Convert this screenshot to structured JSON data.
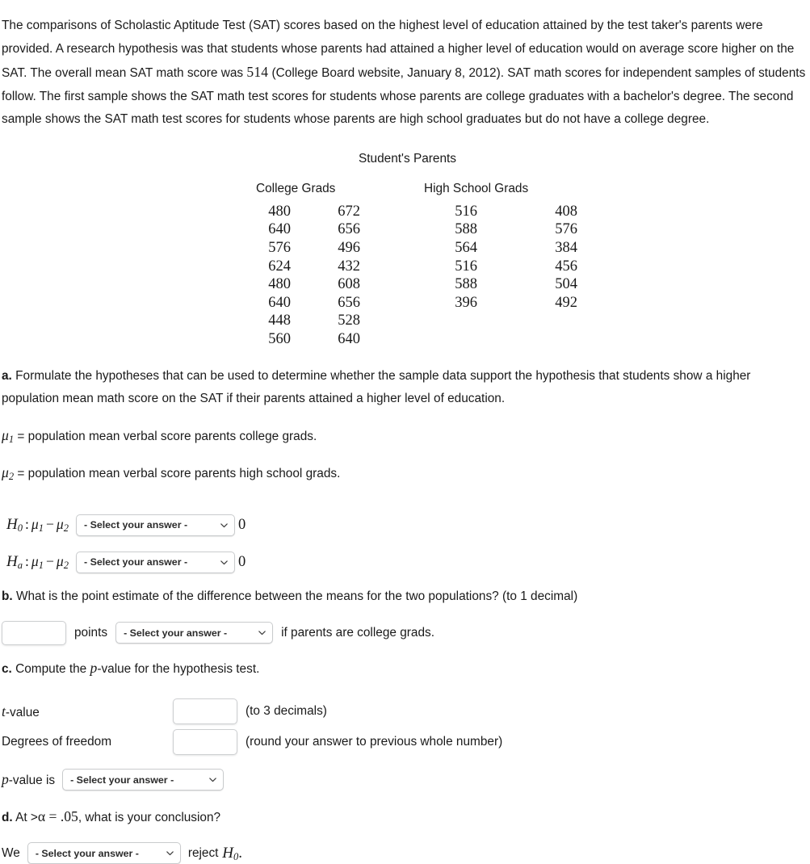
{
  "intro": {
    "part1": "The comparisons of Scholastic Aptitude Test (SAT) scores based on the highest level of education attained by the test taker's parents were provided. A research hypothesis was that students whose parents had attained a higher level of education would on average score higher on the SAT. The overall mean SAT math score was ",
    "mean_value": "514",
    "part2": " (College Board website, January 8, 2012). SAT math scores for independent samples of students follow. The first sample shows the SAT math test scores for students whose parents are college graduates with a bachelor's degree. The second sample shows the SAT math test scores for students whose parents are high school graduates but do not have a college degree."
  },
  "table": {
    "title": "Student's Parents",
    "header_college": "College Grads",
    "header_highschool": "High School Grads",
    "rows": [
      {
        "cg1": "480",
        "cg2": "672",
        "hs1": "516",
        "hs2": "408"
      },
      {
        "cg1": "640",
        "cg2": "656",
        "hs1": "588",
        "hs2": "576"
      },
      {
        "cg1": "576",
        "cg2": "496",
        "hs1": "564",
        "hs2": "384"
      },
      {
        "cg1": "624",
        "cg2": "432",
        "hs1": "516",
        "hs2": "456"
      },
      {
        "cg1": "480",
        "cg2": "608",
        "hs1": "588",
        "hs2": "504"
      },
      {
        "cg1": "640",
        "cg2": "656",
        "hs1": "396",
        "hs2": "492"
      },
      {
        "cg1": "448",
        "cg2": "528",
        "hs1": "",
        "hs2": ""
      },
      {
        "cg1": "560",
        "cg2": "640",
        "hs1": "",
        "hs2": ""
      }
    ]
  },
  "part_a": {
    "marker": "a.",
    "text": " Formulate the hypotheses that can be used to determine whether the sample data support the hypothesis that students show a higher population mean math score on the SAT if their parents attained a higher level of education.",
    "mu1_def": " = population mean verbal score parents college grads.",
    "mu2_def": " = population mean verbal score parents high school grads.",
    "h0_select": "- Select your answer -",
    "h0_value": "0",
    "ha_select": "- Select your answer -",
    "ha_value": "0"
  },
  "part_b": {
    "marker": "b.",
    "text": " What is the point estimate of the difference between the means for the two populations? (to 1 decimal)",
    "input_value": "",
    "points_label": "points",
    "select": "- Select your answer -",
    "trailing": "if parents are college grads."
  },
  "part_c": {
    "marker": "c.",
    "text_before": " Compute the ",
    "text_after": "-value for the hypothesis test.",
    "t_label": "-value",
    "t_input_value": "",
    "t_note": "(to 3 decimals)",
    "df_label": "Degrees of freedom",
    "df_input_value": "",
    "df_note": "(round your answer to previous whole number)",
    "p_label": "-value is",
    "p_select": "- Select your answer -"
  },
  "part_d": {
    "marker": "d.",
    "text_before": " At >",
    "alpha_expr": " = .05",
    "text_after": ", what is your conclusion?",
    "we_label": "We",
    "select": "- Select your answer -",
    "reject_label": "reject"
  },
  "icons": {
    "chevron": "chevron-down-icon"
  },
  "colors": {
    "text": "#1a1a1a",
    "border": "#c9cbcd",
    "background": "#ffffff"
  }
}
